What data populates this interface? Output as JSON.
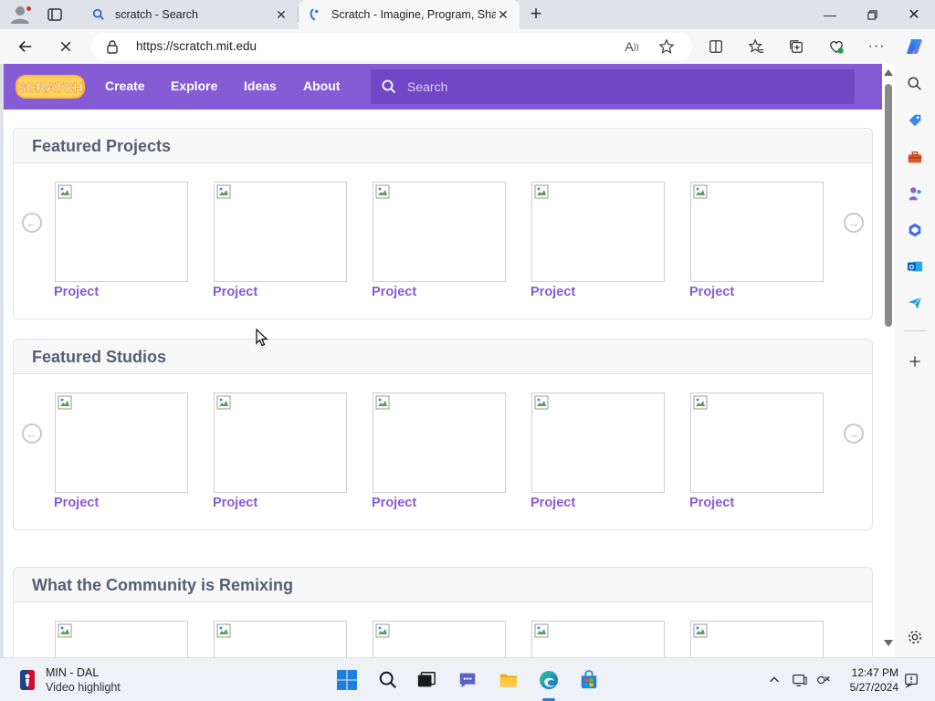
{
  "browser": {
    "tabs": [
      {
        "title": "scratch - Search",
        "icon": "search-icon",
        "active": false
      },
      {
        "title": "Scratch - Imagine, Program, Share",
        "icon": "scratch-favicon-icon",
        "active": true
      }
    ],
    "address": {
      "url": "https://scratch.mit.edu"
    }
  },
  "scratch": {
    "logo_text": "SCRATCH",
    "nav": {
      "create": "Create",
      "explore": "Explore",
      "ideas": "Ideas",
      "about": "About"
    },
    "search_placeholder": "Search",
    "brand_color": "#855cd6",
    "sections": [
      {
        "title": "Featured Projects",
        "tiles": [
          "Project",
          "Project",
          "Project",
          "Project",
          "Project"
        ]
      },
      {
        "title": "Featured Studios",
        "tiles": [
          "Project",
          "Project",
          "Project",
          "Project",
          "Project"
        ]
      },
      {
        "title": "What the Community is Remixing",
        "tiles": [
          "",
          "",
          "",
          "",
          ""
        ]
      }
    ]
  },
  "taskbar": {
    "widget": {
      "line1": "MIN - DAL",
      "line2": "Video highlight"
    },
    "clock": {
      "time": "12:47 PM",
      "date": "5/27/2024"
    }
  }
}
